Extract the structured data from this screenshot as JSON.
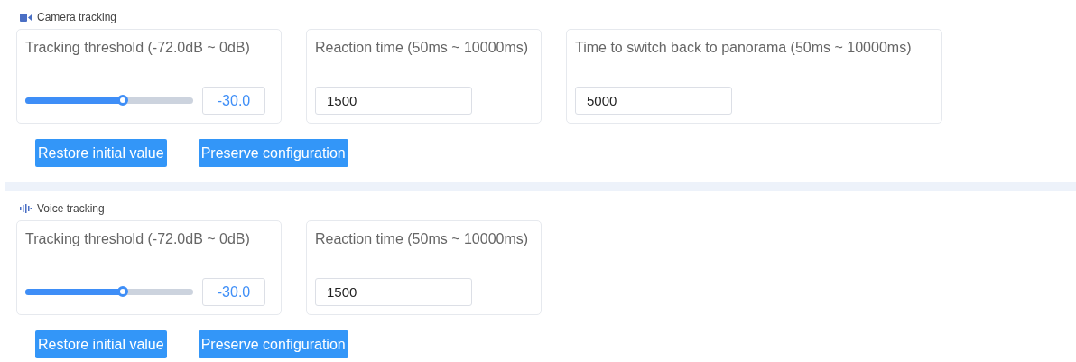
{
  "sections": [
    {
      "title": "Camera tracking",
      "kind": "camera",
      "fields": [
        {
          "kind": "slider",
          "label": "Tracking threshold (-72.0dB ~ 0dB)",
          "level": 0.58,
          "value": "-30.0"
        },
        {
          "kind": "number",
          "label": "Reaction time (50ms ~ 10000ms)",
          "value": "1500"
        },
        {
          "kind": "number",
          "label": "Time to switch back to panorama (50ms ~ 10000ms)",
          "value": "5000"
        }
      ],
      "buttons": [
        "Restore initial value",
        "Preserve configuration"
      ]
    },
    {
      "title": "Voice tracking",
      "kind": "voice",
      "fields": [
        {
          "kind": "slider",
          "label": "Tracking threshold (-72.0dB ~ 0dB)",
          "level": 0.58,
          "value": "-30.0"
        },
        {
          "kind": "number",
          "label": "Reaction time (50ms ~ 10000ms)",
          "value": "1500"
        }
      ],
      "buttons": [
        "Restore initial value",
        "Preserve configuration"
      ]
    }
  ]
}
